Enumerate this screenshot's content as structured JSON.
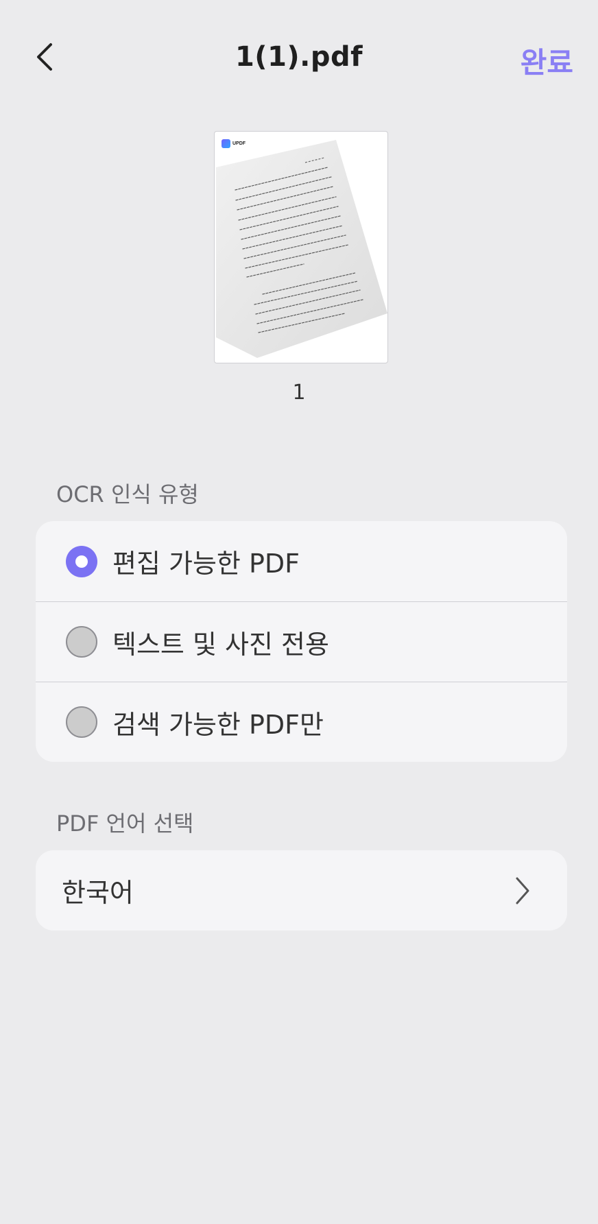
{
  "header": {
    "title": "1(1).pdf",
    "done_label": "완료",
    "accent_color": "#8a7ff4"
  },
  "thumbnail": {
    "page_number": "1",
    "logo_text": "UPDF"
  },
  "ocr_section": {
    "label": "OCR 인식 유형",
    "options": [
      {
        "label": "편집 가능한 PDF",
        "selected": true
      },
      {
        "label": "텍스트 및 사진 전용",
        "selected": false
      },
      {
        "label": "검색 가능한 PDF만",
        "selected": false
      }
    ]
  },
  "language_section": {
    "label": "PDF 언어 선택",
    "value": "한국어"
  }
}
